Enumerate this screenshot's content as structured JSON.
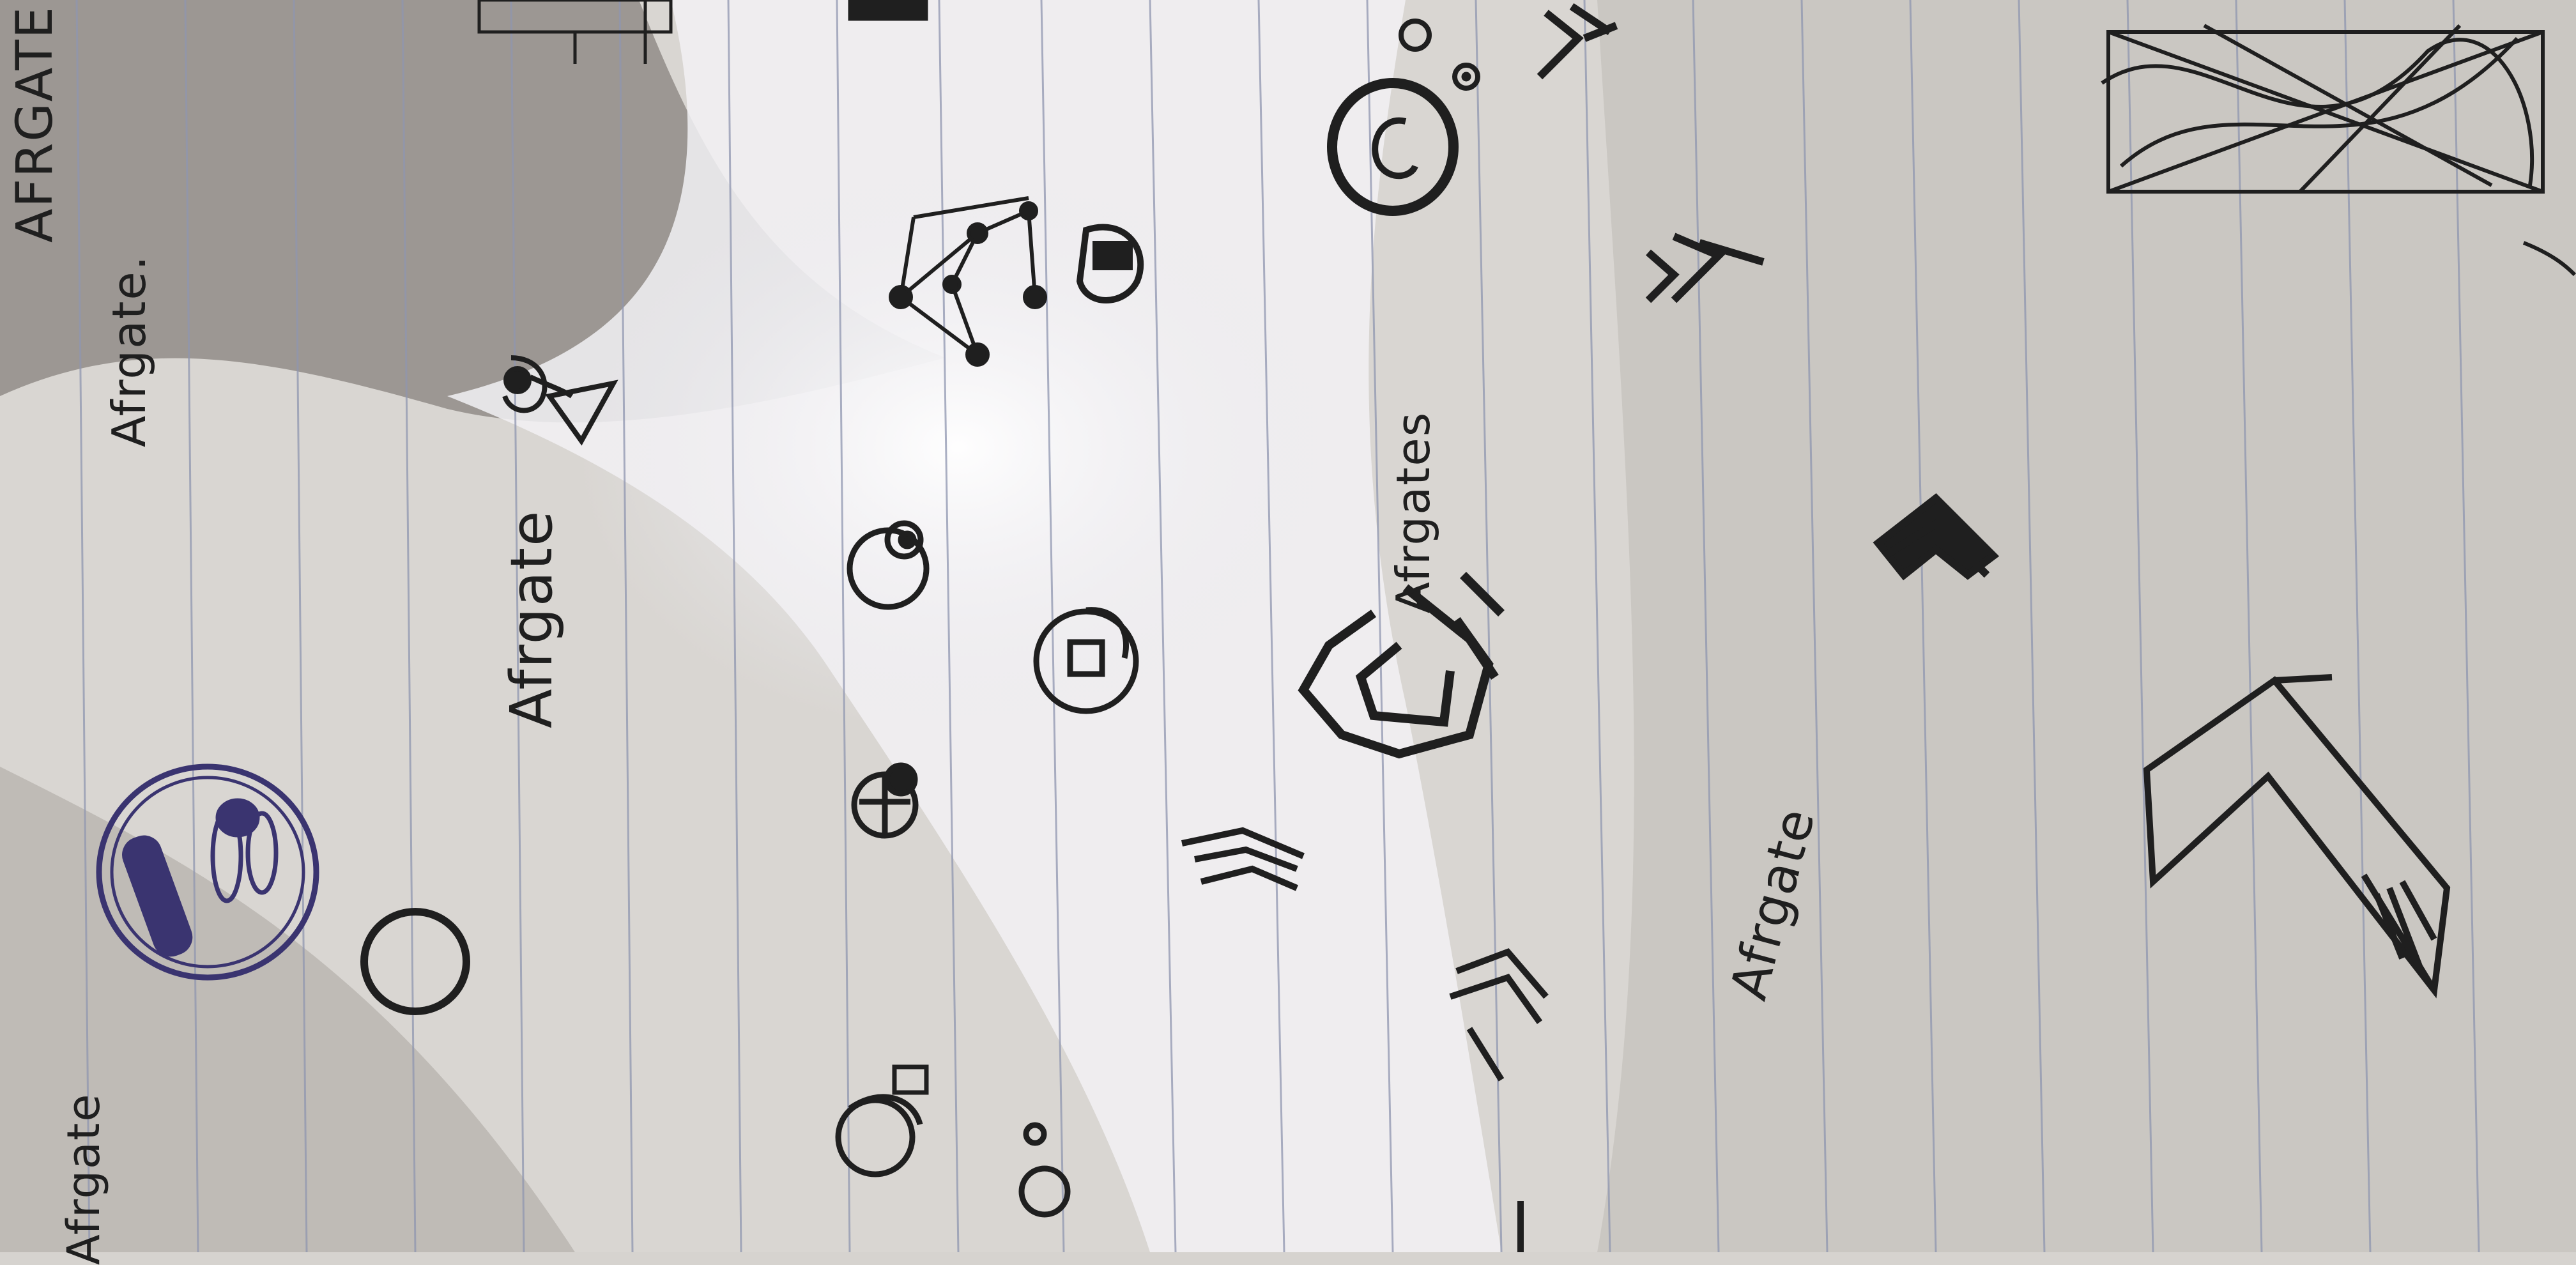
{
  "photo": {
    "subject": "handwritten logo sketches on ruled notebook paper, photographed rotated",
    "paper_color": "#d9d6d2",
    "rule_line_color": "#8f96b0",
    "ink_color": "#1f1f1f",
    "blue_ink_color": "#3a3470",
    "light_patch_color": "#f4f3f6",
    "shadow_color": "#6f6a64"
  },
  "texts": {
    "top_caps": "AFRGATE",
    "left_edge": "Afrgate",
    "second_line": "Afrgate.",
    "middle_word": "Afrgate",
    "logo_word": "Afrgates",
    "bottom_word": "Afrgate"
  }
}
